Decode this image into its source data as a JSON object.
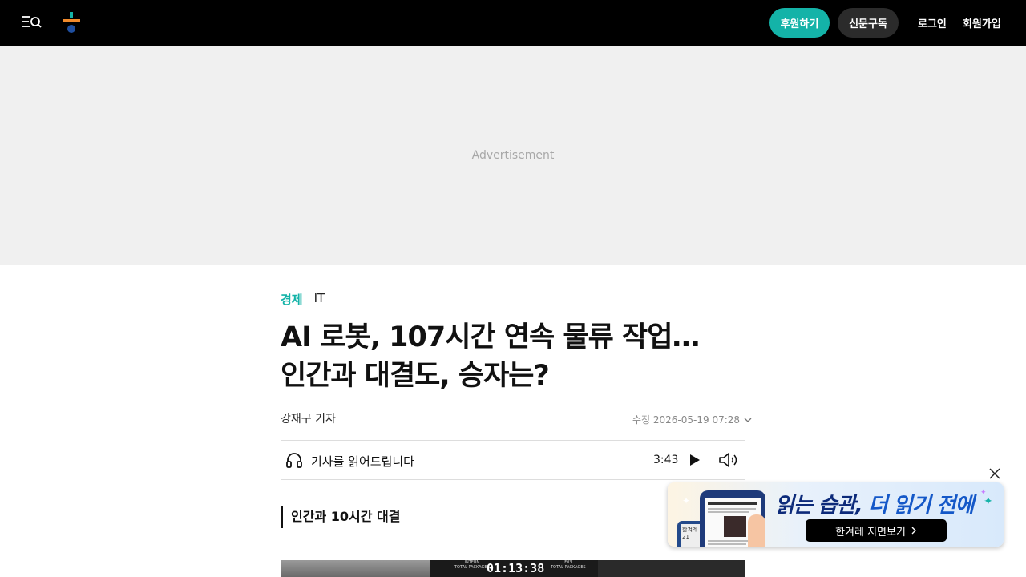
{
  "header": {
    "support_label": "후원하기",
    "subscribe_label": "신문구독",
    "login_label": "로그인",
    "signup_label": "회원가입",
    "brand_colors": {
      "teal": "#14b3a8",
      "orange": "#f08a2c",
      "navy": "#1f4fa0"
    }
  },
  "ad": {
    "label": "Advertisement"
  },
  "article": {
    "section": "경제",
    "subsection": "IT",
    "title_line1": "AI 로봇, 107시간 연속 물류 작업…",
    "title_line2": "인간과 대결도, 승자는?",
    "byline": "강재구 기자",
    "modified": "수정 2026-05-19 07:28",
    "subheading": "인간과 10시간 대결"
  },
  "audio_player": {
    "label": "기사를 읽어드립니다",
    "duration": "3:43",
    "icons": [
      "headphones-icon",
      "play-icon",
      "volume-icon"
    ]
  },
  "photo": {
    "left_label_line1": "INTERN",
    "left_label_line2": "TOTAL PACKAGES",
    "timer": "01:13:38",
    "right_label_line1": "F03",
    "right_label_line2": "TOTAL PACKAGES"
  },
  "promo": {
    "tagline_part1": "읽는 습관,",
    "tagline_part2": "더 읽기 전에",
    "cta_label": "한겨레 지면보기",
    "mini_label": "한겨레 21"
  }
}
